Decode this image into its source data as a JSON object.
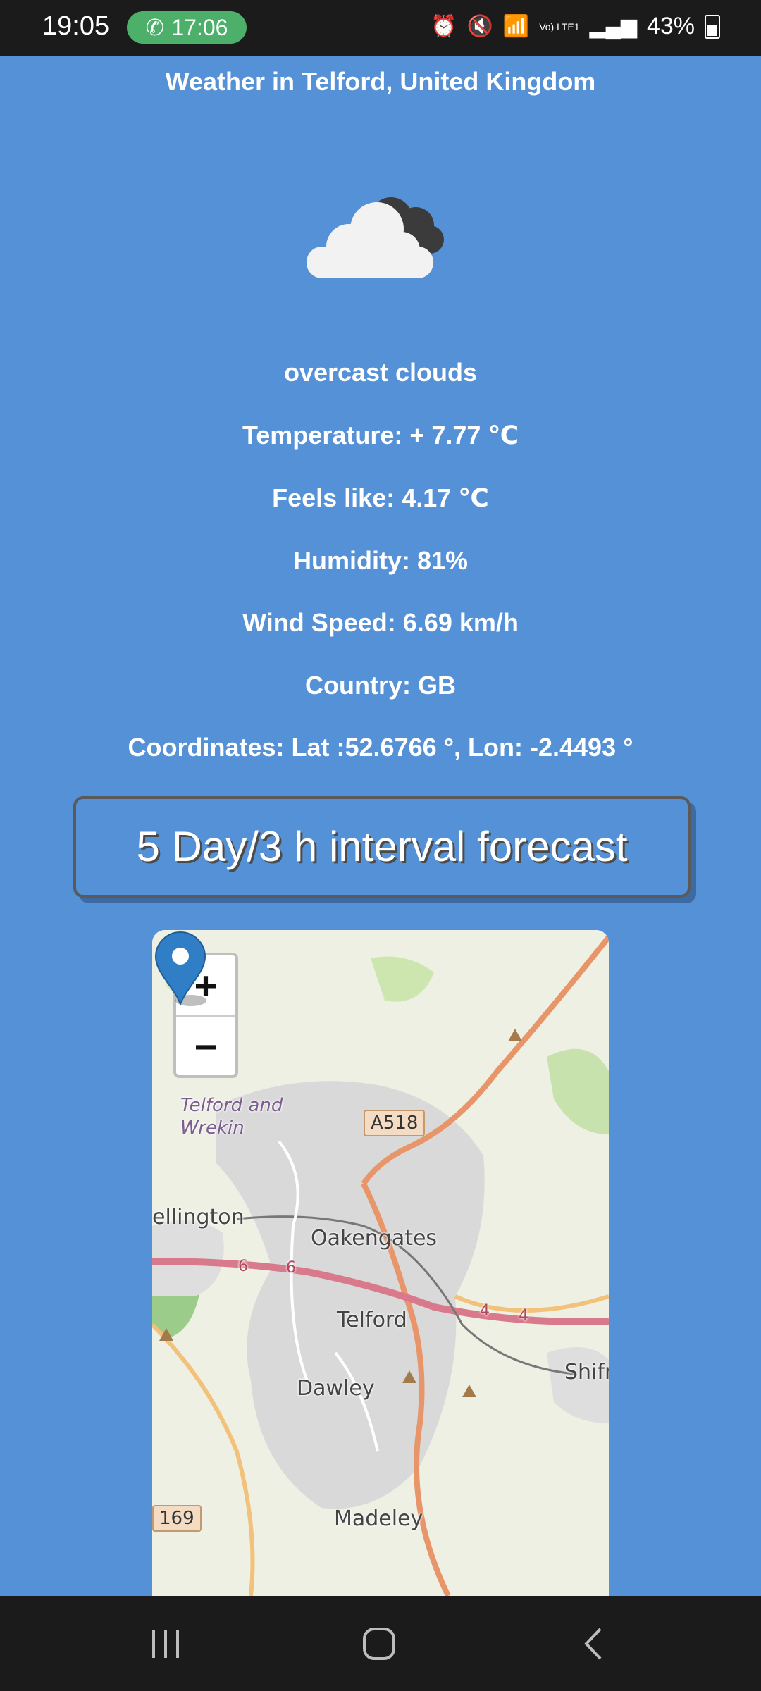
{
  "status_bar": {
    "time": "19:05",
    "call_duration": "17:06",
    "battery": "43%",
    "network_label": "Vo) LTE1",
    "icons": [
      "alarm-icon",
      "mute-icon",
      "wifi-icon",
      "signal-icon",
      "battery-icon"
    ]
  },
  "header": {
    "title": "Weather in Telford, United Kingdom"
  },
  "weather": {
    "icon": "overcast-cloud-icon",
    "description": "overcast clouds",
    "temperature": "Temperature: + 7.77 ℃",
    "feels_like": "Feels like: 4.17 ℃",
    "humidity": "Humidity: 81%",
    "wind_speed": "Wind Speed: 6.69 km/h",
    "country": "Country: GB",
    "coordinates": "Coordinates: Lat :52.6766 °, Lon: -2.4493 °"
  },
  "forecast_button": {
    "label": "5 Day/3 h interval forecast"
  },
  "map": {
    "zoom_in": "+",
    "zoom_out": "−",
    "labels": {
      "district": "Telford and Wrekin",
      "wellington": "ellington",
      "oakengates": "Oakengates",
      "telford": "Telford",
      "dawley": "Dawley",
      "madeley": "Madeley",
      "shifnal": "Shifn"
    },
    "roads": {
      "a518": "A518",
      "a4169": "169",
      "m54_a": "6",
      "m54_b": "6",
      "m54_c": "4",
      "m54_d": "4"
    },
    "marker": "location-pin-icon"
  },
  "nav_bar": {
    "items": [
      "recent-apps",
      "home",
      "back"
    ]
  }
}
